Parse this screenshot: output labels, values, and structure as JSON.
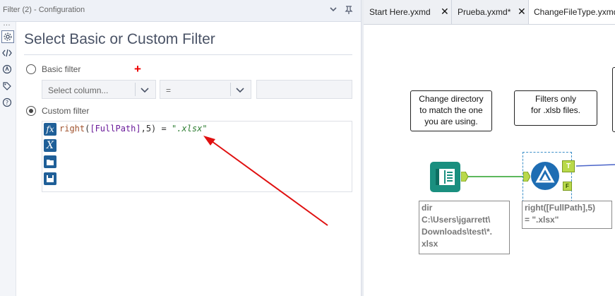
{
  "config_panel": {
    "title": "Filter (2) - Configuration",
    "heading": "Select Basic or Custom Filter",
    "basic_filter_label": "Basic filter",
    "select_column_placeholder": "Select column...",
    "operator_value": "=",
    "value_field": "",
    "custom_filter_label": "Custom filter",
    "expression": {
      "fn": "right",
      "open": "(",
      "field": "[FullPath]",
      "rest": ",5) = ",
      "string": "\".xlsx\""
    },
    "sidebar_icons": [
      "gear-icon",
      "code-icon",
      "compass-icon",
      "tag-icon",
      "help-icon"
    ],
    "editor_icons": [
      "fx-icon",
      "variable-icon",
      "open-file-icon",
      "save-file-icon"
    ]
  },
  "workflow": {
    "tabs": [
      {
        "label": "Start Here.yxmd",
        "closable": true
      },
      {
        "label": "Prueba.yxmd*",
        "closable": true
      },
      {
        "label": "ChangeFileType.yxmd",
        "closable": false,
        "active": true
      }
    ],
    "notes": [
      {
        "text_lines": [
          "Change directory",
          "to match the one",
          "you are using."
        ]
      },
      {
        "text_lines": [
          "Filters only",
          "for .xlsb files."
        ]
      }
    ],
    "filter_anchor_true": "T",
    "filter_anchor_false": "F",
    "dir_annotation": "dir\nC:\\Users\\jgarrett\\\nDownloads\\test\\*.\nxlsx",
    "filter_annotation": "right([FullPath],5)\n= \".xlsx\""
  },
  "colors": {
    "accent_blue": "#1f5f98",
    "arrow_red": "#e01010",
    "input_tool_green": "#1a8f7f",
    "filter_tool_blue": "#1e6db3",
    "anchor_green": "#b9d94a",
    "connection_green": "#5cb85c"
  }
}
